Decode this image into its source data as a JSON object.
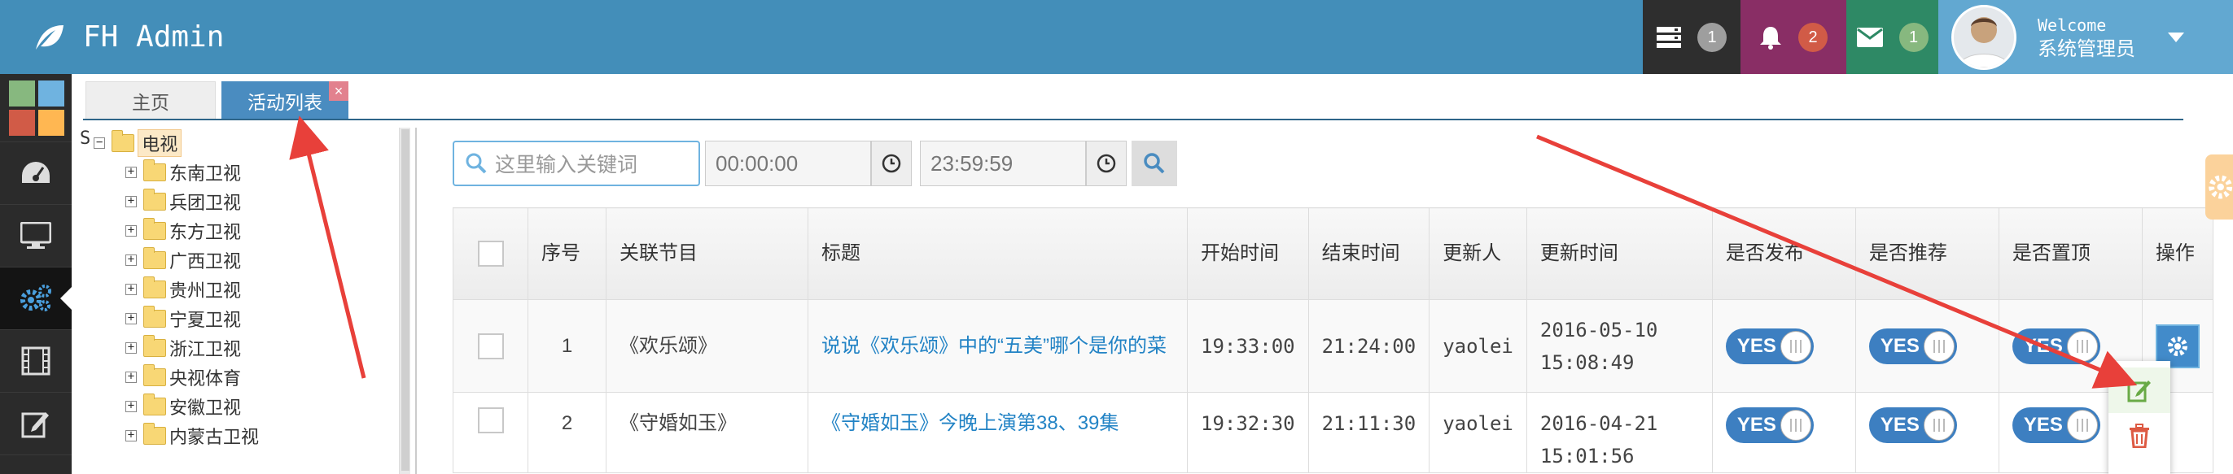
{
  "brand": {
    "name": "FH Admin"
  },
  "nav": {
    "tasks_count": "1",
    "notifications_count": "2",
    "messages_count": "1",
    "badge_colors": {
      "tasks": "#9e9e9e",
      "notifications": "#d15b47",
      "messages": "#87b87f"
    }
  },
  "user": {
    "welcome": "Welcome",
    "name": "系统管理员"
  },
  "sidebar": {
    "icons": [
      "tiles-icon",
      "dashboard-icon",
      "monitor-icon",
      "gears-icon",
      "film-icon",
      "edit-icon"
    ]
  },
  "tabs": [
    {
      "label": "主页"
    },
    {
      "label": "活动列表"
    }
  ],
  "tab_close": "×",
  "tree": {
    "prefix": "S",
    "root": "电视",
    "children": [
      "东南卫视",
      "兵团卫视",
      "东方卫视",
      "广西卫视",
      "贵州卫视",
      "宁夏卫视",
      "浙江卫视",
      "央视体育",
      "安徽卫视",
      "内蒙古卫视"
    ]
  },
  "filters": {
    "search_placeholder": "这里输入关键词",
    "start_time": "00:00:00",
    "end_time": "23:59:59"
  },
  "table": {
    "headers": [
      "",
      "序号",
      "关联节目",
      "标题",
      "开始时间",
      "结束时间",
      "更新人",
      "更新时间",
      "是否发布",
      "是否推荐",
      "是否置顶",
      "操作"
    ],
    "rows": [
      {
        "no": "1",
        "program": "《欢乐颂》",
        "title": "说说《欢乐颂》中的“五美”哪个是你的菜",
        "start": "19:33:00",
        "end": "21:24:00",
        "updater": "yaolei",
        "updated": "2016-05-10 15:08:49",
        "published": "YES",
        "recommended": "YES",
        "top": "YES"
      },
      {
        "no": "2",
        "program": "《守婚如玉》",
        "title": "《守婚如玉》今晚上演第38、39集",
        "start": "19:32:30",
        "end": "21:11:30",
        "updater": "yaolei",
        "updated": "2016-04-21 15:01:56",
        "published": "YES",
        "recommended": "YES",
        "top": "YES"
      }
    ]
  },
  "colors": {
    "navbar": "#438eb9",
    "accent": "#2283c5",
    "annotation_arrow": "#e8403a"
  }
}
